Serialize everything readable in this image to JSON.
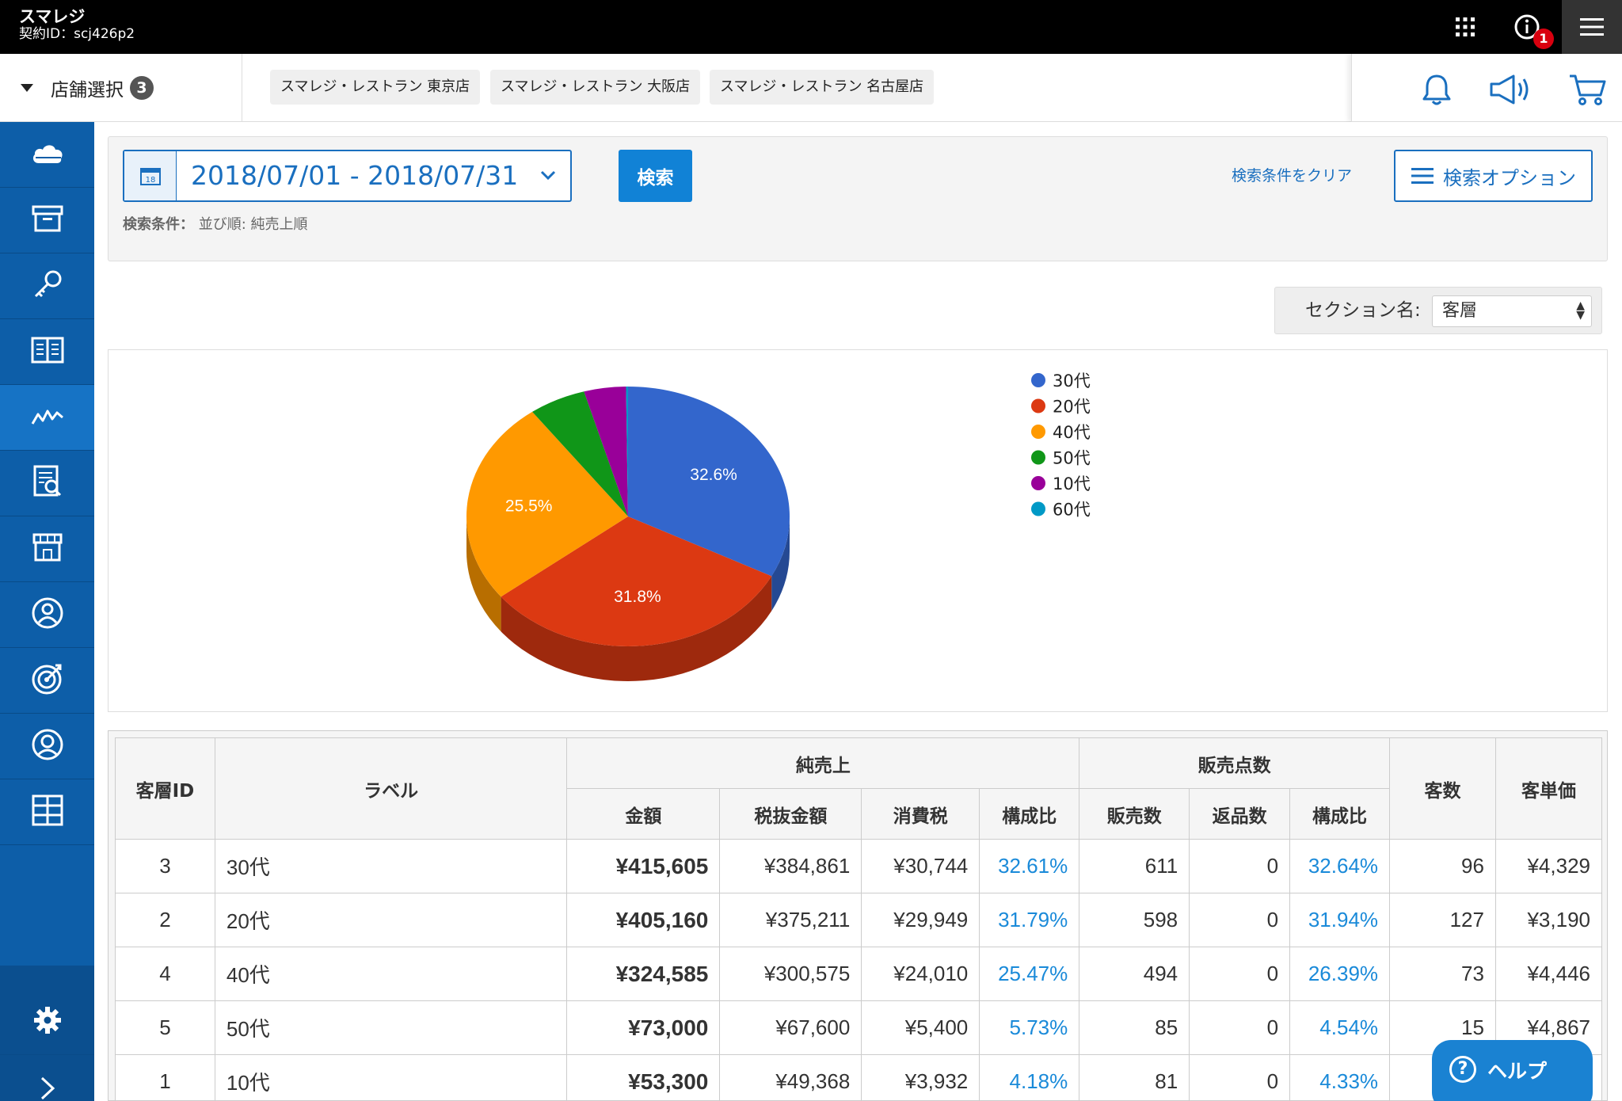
{
  "app": {
    "brand": "スマレジ",
    "contract": "契約ID：scj426p2",
    "info_badge": "1"
  },
  "store_bar": {
    "select_label": "店舗選択",
    "count": "3",
    "stores": [
      "スマレジ・レストラン 東京店",
      "スマレジ・レストラン 大阪店",
      "スマレジ・レストラン 名古屋店"
    ]
  },
  "sidebar": {
    "items": [
      "cloud-icon",
      "box-icon",
      "key-icon",
      "book-icon",
      "chart-line-icon",
      "report-icon",
      "store-icon",
      "user-icon",
      "target-icon",
      "customer-icon",
      "apps-grid-icon"
    ],
    "active_index": 4
  },
  "search": {
    "date_range": "2018/07/01 - 2018/07/31",
    "calendar_day": "18",
    "search_button": "検索",
    "clear_link": "検索条件をクリア",
    "options_button": "検索オプション",
    "condition_label": "検索条件：",
    "condition_value": "並び順: 純売上順"
  },
  "section": {
    "label": "セクション名:",
    "value": "客層"
  },
  "chart_data": {
    "type": "pie",
    "categories": [
      "30代",
      "20代",
      "40代",
      "50代",
      "10代",
      "60代"
    ],
    "values": [
      32.6,
      31.8,
      25.5,
      5.7,
      4.2,
      0.2
    ],
    "data_labels": [
      "32.6%",
      "31.8%",
      "25.5%",
      "",
      "",
      ""
    ],
    "colors": [
      "#3366cc",
      "#dc3912",
      "#ff9900",
      "#109618",
      "#990099",
      "#0099c6"
    ],
    "legend_position": "right",
    "three_d": true
  },
  "table": {
    "headers": {
      "id": "客層ID",
      "label": "ラベル",
      "net_sales": "純売上",
      "sales_count": "販売点数",
      "customers": "客数",
      "unit_price": "客単価",
      "amount": "金額",
      "tax_excluded": "税抜金額",
      "tax": "消費税",
      "ratio": "構成比",
      "sold": "販売数",
      "returned": "返品数",
      "ratio2": "構成比"
    },
    "rows": [
      {
        "id": "3",
        "label": "30代",
        "amount": "¥415,605",
        "tax_excluded": "¥384,861",
        "tax": "¥30,744",
        "ratio": "32.61%",
        "sold": "611",
        "returned": "0",
        "ratio2": "32.64%",
        "customers": "96",
        "unit_price": "¥4,329"
      },
      {
        "id": "2",
        "label": "20代",
        "amount": "¥405,160",
        "tax_excluded": "¥375,211",
        "tax": "¥29,949",
        "ratio": "31.79%",
        "sold": "598",
        "returned": "0",
        "ratio2": "31.94%",
        "customers": "127",
        "unit_price": "¥3,190"
      },
      {
        "id": "4",
        "label": "40代",
        "amount": "¥324,585",
        "tax_excluded": "¥300,575",
        "tax": "¥24,010",
        "ratio": "25.47%",
        "sold": "494",
        "returned": "0",
        "ratio2": "26.39%",
        "customers": "73",
        "unit_price": "¥4,446"
      },
      {
        "id": "5",
        "label": "50代",
        "amount": "¥73,000",
        "tax_excluded": "¥67,600",
        "tax": "¥5,400",
        "ratio": "5.73%",
        "sold": "85",
        "returned": "0",
        "ratio2": "4.54%",
        "customers": "15",
        "unit_price": "¥4,867"
      },
      {
        "id": "1",
        "label": "10代",
        "amount": "¥53,300",
        "tax_excluded": "¥49,368",
        "tax": "¥3,932",
        "ratio": "4.18%",
        "sold": "81",
        "returned": "0",
        "ratio2": "4.33%",
        "customers": "",
        "unit_price": ""
      }
    ]
  },
  "help": {
    "label": "ヘルプ"
  }
}
